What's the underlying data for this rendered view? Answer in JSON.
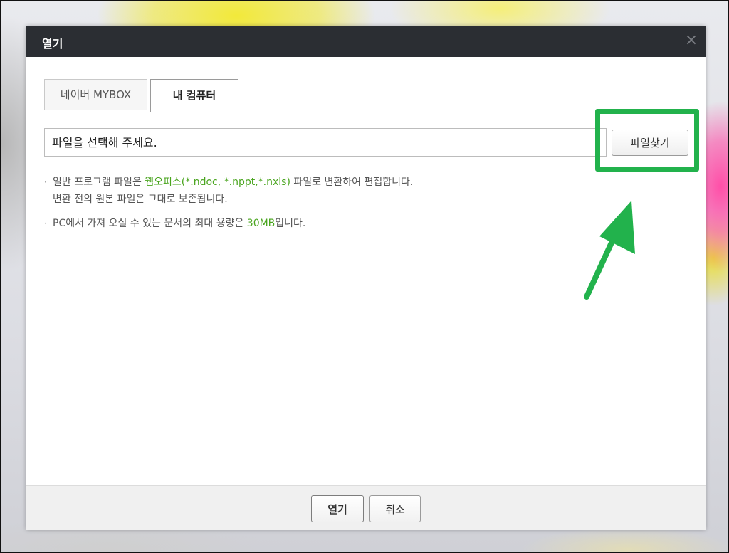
{
  "dialog": {
    "title": "열기",
    "close_icon": "×"
  },
  "tabs": [
    {
      "label": "네이버 MYBOX",
      "selected": false
    },
    {
      "label": "내 컴퓨터",
      "selected": true
    }
  ],
  "file": {
    "placeholder": "파일을 선택해 주세요.",
    "browse_label": "파일찾기"
  },
  "notes": {
    "note1_pre": "일반 프로그램 파일은 ",
    "note1_green": "웹오피스(*.ndoc, *.nppt,*.nxls)",
    "note1_post": " 파일로 변환하여 편집합니다.",
    "note1_line2": "변환 전의 원본 파일은 그대로 보존됩니다.",
    "note2_pre": "PC에서 가져 오실 수 있는 문서의 최대 용량은 ",
    "note2_green": "30MB",
    "note2_post": "입니다.",
    "bullet": "·"
  },
  "footer": {
    "open_label": "열기",
    "cancel_label": "취소"
  },
  "colors": {
    "titlebar": "#2b2e33",
    "highlight": "#22b24c",
    "link_green": "#4aa51f"
  },
  "icons": {
    "close": "close-icon",
    "annotation_arrow": "arrow-up-right-icon"
  }
}
